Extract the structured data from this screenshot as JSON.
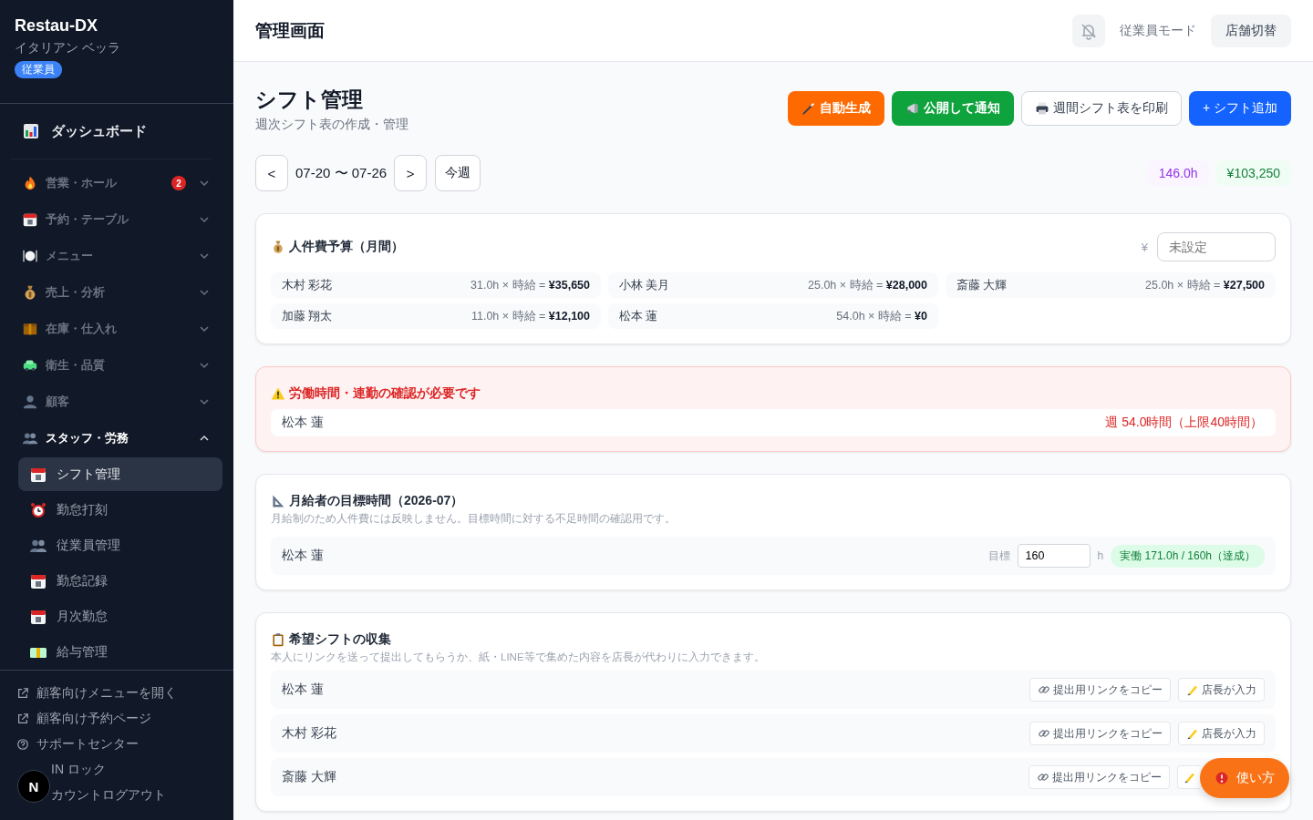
{
  "brand": {
    "name": "Restau-DX",
    "store": "イタリアン ベッラ",
    "role": "従業員"
  },
  "sidebar": {
    "dashboard": {
      "label": "ダッシュボード",
      "selected": false
    },
    "groups": [
      {
        "label": "営業・ホール",
        "badge": "2",
        "expanded": false
      },
      {
        "label": "予約・テーブル",
        "expanded": false
      },
      {
        "label": "メニュー",
        "expanded": false
      },
      {
        "label": "売上・分析",
        "expanded": false
      },
      {
        "label": "在庫・仕入れ",
        "expanded": false
      },
      {
        "label": "衛生・品質",
        "expanded": false
      },
      {
        "label": "顧客",
        "expanded": false
      },
      {
        "label": "スタッフ・労務",
        "expanded": true,
        "children": [
          {
            "label": "シフト管理",
            "selected": true
          },
          {
            "label": "勤怠打刻",
            "selected": false
          },
          {
            "label": "従業員管理",
            "selected": false
          },
          {
            "label": "勤怠記録",
            "selected": false
          },
          {
            "label": "月次勤怠",
            "selected": false
          },
          {
            "label": "給与管理",
            "selected": false
          }
        ]
      }
    ],
    "footer_links": [
      {
        "label": "顧客向けメニューを開く",
        "kind": "external",
        "covered": false
      },
      {
        "label": "顧客向け予約ページ",
        "kind": "external",
        "covered": false
      },
      {
        "label": "サポートセンター",
        "kind": "help",
        "covered": false
      },
      {
        "label": "IN ロック",
        "covered": true
      },
      {
        "label": "カウントログアウト",
        "covered": true
      }
    ]
  },
  "dev_badge": "N",
  "header": {
    "title": "管理画面",
    "notifications_muted": true,
    "mode": "従業員モード",
    "switch_store": "店舗切替"
  },
  "page": {
    "title": "シフト管理",
    "subtitle": "週次シフト表の作成・管理",
    "actions": [
      {
        "label": "自動生成",
        "kind": "auto"
      },
      {
        "label": "公開して通知",
        "kind": "publish"
      },
      {
        "label": "週間シフト表を印刷",
        "kind": "print"
      },
      {
        "label": "+ シフト追加",
        "kind": "add"
      }
    ]
  },
  "week": {
    "prev": "<",
    "range": "07-20 〜 07-26",
    "next": ">",
    "today": "今週",
    "total_hours": "146.0h",
    "total_cost": "¥103,250"
  },
  "budget": {
    "title": "人件費予算（月間）",
    "currency": "¥",
    "placeholder": "未設定",
    "staff": [
      {
        "name": "木村 彩花",
        "calc": "31.0h × 時給 = **¥35,650**"
      },
      {
        "name": "小林 美月",
        "calc": "25.0h × 時給 = **¥28,000**"
      },
      {
        "name": "斎藤 大輝",
        "calc": "25.0h × 時給 = **¥27,500**"
      },
      {
        "name": "加藤 翔太",
        "calc": "11.0h × 時給 = **¥12,100**"
      },
      {
        "name": "松本 蓮",
        "calc": "54.0h × 時給 = **¥0**"
      }
    ]
  },
  "alert": {
    "title": "労働時間・連勤の確認が必要です",
    "rows": [
      {
        "name": "松本 蓮",
        "message": "週 54.0時間（上限40時間）"
      }
    ]
  },
  "target": {
    "title": "月給者の目標時間（2026-07）",
    "note": "月給制のため人件費には反映しません。目標時間に対する不足時間の確認用です。",
    "rows": [
      {
        "name": "松本 蓮",
        "label": "目標",
        "value": "160",
        "unit": "h",
        "status": "実働 171.0h / 160h（達成）",
        "achieved": true
      }
    ]
  },
  "wishes": {
    "title": "希望シフトの収集",
    "note": "本人にリンクを送って提出してもらうか、紙・LINE等で集めた内容を店長が代わりに入力できます。",
    "rows": [
      {
        "name": "松本 蓮",
        "copy": "提出用リンクをコピー",
        "enter": "店長が入力"
      },
      {
        "name": "木村 彩花",
        "copy": "提出用リンクをコピー",
        "enter": "店長が入力"
      },
      {
        "name": "斎藤 大輝",
        "copy": "提出用リンクをコピー"
      }
    ]
  },
  "help_button": "使い方"
}
